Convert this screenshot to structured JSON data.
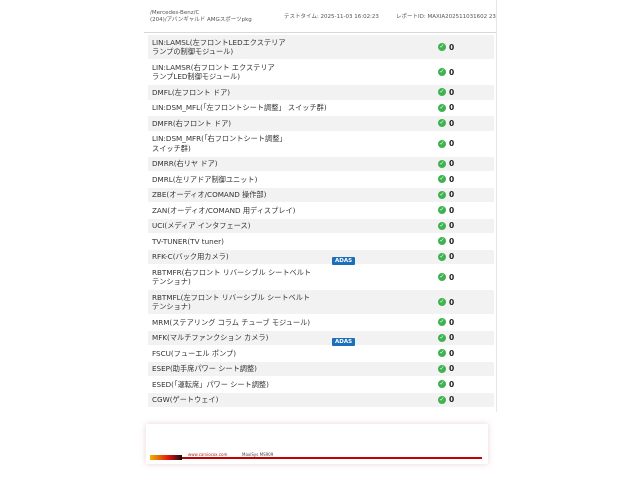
{
  "header": {
    "vehicle_line1": "/Mercedes-Benz/C",
    "vehicle_line2": "(204)/アバンギャルド AMGスポーツpkg",
    "test_time_label": "テストタイム:",
    "test_time_value": "2025-11-03 16:02:23",
    "report_id_label": "レポートID:",
    "report_id_value": "MAXIA202511031602 23"
  },
  "rows": [
    {
      "line1": "LIN:LAMSL(左フロントLEDエクステリア",
      "line2": "ランプの制御モジュール)",
      "badge": "",
      "value": "0"
    },
    {
      "line1": "LIN:LAMSR(右フロント エクステリア",
      "line2": "ランプLED制御モジュール)",
      "badge": "",
      "value": "0"
    },
    {
      "line1": "DMFL(左フロント ドア)",
      "line2": "",
      "badge": "",
      "value": "0"
    },
    {
      "line1": "LIN:DSM_MFL(「左フロントシート調整」 スイッチ群)",
      "line2": "",
      "badge": "",
      "value": "0"
    },
    {
      "line1": "DMFR(右フロント ドア)",
      "line2": "",
      "badge": "",
      "value": "0"
    },
    {
      "line1": "LIN:DSM_MFR(「右フロントシート調整」",
      "line2": "スイッチ群)",
      "badge": "",
      "value": "0"
    },
    {
      "line1": "DMRR(右リヤ ドア)",
      "line2": "",
      "badge": "",
      "value": "0"
    },
    {
      "line1": "DMRL(左リアドア制御ユニット)",
      "line2": "",
      "badge": "",
      "value": "0"
    },
    {
      "line1": "ZBE(オーディオ/COMAND 操作部)",
      "line2": "",
      "badge": "",
      "value": "0"
    },
    {
      "line1": "ZAN(オーディオ/COMAND 用ディスプレイ)",
      "line2": "",
      "badge": "",
      "value": "0"
    },
    {
      "line1": "UCI(メディア インタフェース)",
      "line2": "",
      "badge": "",
      "value": "0"
    },
    {
      "line1": "TV-TUNER(TV tuner)",
      "line2": "",
      "badge": "",
      "value": "0"
    },
    {
      "line1": "RFK-C(バック用カメラ)",
      "line2": "",
      "badge": "ADAS",
      "value": "0"
    },
    {
      "line1": "RBTMFR(右フロント リバーシブル シートベルト",
      "line2": "テンショナ)",
      "badge": "",
      "value": "0"
    },
    {
      "line1": "RBTMFL(左フロント リバーシブル シートベルト",
      "line2": "テンショナ)",
      "badge": "",
      "value": "0"
    },
    {
      "line1": "MRM(ステアリング コラム チューブ モジュール)",
      "line2": "",
      "badge": "",
      "value": "0"
    },
    {
      "line1": "MFK(マルチファンクション カメラ)",
      "line2": "",
      "badge": "ADAS",
      "value": "0"
    },
    {
      "line1": "FSCU(フューエル ポンプ)",
      "line2": "",
      "badge": "",
      "value": "0"
    },
    {
      "line1": "ESEP(助手席パワー シート調整)",
      "line2": "",
      "badge": "",
      "value": "0"
    },
    {
      "line1": "ESED(「運転席」パワー シート調整)",
      "line2": "",
      "badge": "",
      "value": "0"
    },
    {
      "line1": "CGW(ゲートウェイ)",
      "line2": "",
      "badge": "",
      "value": "0"
    }
  ],
  "status_icon": "check-circle-icon",
  "colors": {
    "ok": "#3fb34f",
    "badge": "#1c6fb8",
    "row_alt": "#f2f2f2"
  },
  "footer": {
    "url": "www.carsiocox.com",
    "model": "MaxiSys MS909"
  }
}
